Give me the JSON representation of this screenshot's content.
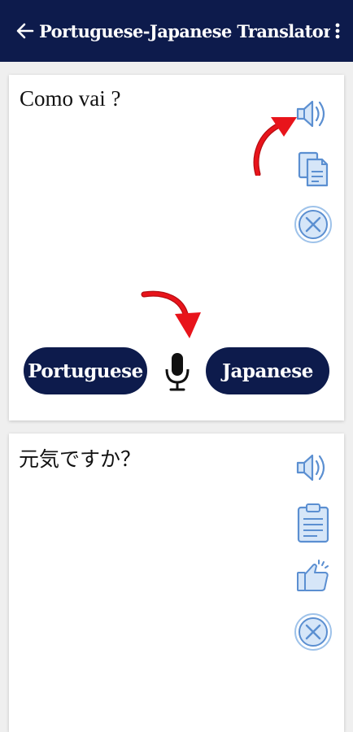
{
  "header": {
    "title": "Portuguese-Japanese Translator",
    "back_icon": "arrow-left-icon",
    "menu_icon": "more-vertical-icon",
    "background": "#0d1b4c"
  },
  "source": {
    "text": "Como vai ?",
    "actions": [
      "speaker-icon",
      "copy-icon",
      "clear-icon"
    ]
  },
  "languages": {
    "source_label": "Portuguese",
    "target_label": "Japanese",
    "mic_icon": "microphone-icon"
  },
  "target": {
    "text": "元気ですか？",
    "actions": [
      "speaker-icon",
      "clipboard-icon",
      "like-icon",
      "clear-icon"
    ]
  },
  "colors": {
    "primary": "#0d1b4c",
    "icon_blue": "#5b8fd1",
    "icon_fill": "#d6e6f8",
    "annotation_red": "#e8141b"
  }
}
